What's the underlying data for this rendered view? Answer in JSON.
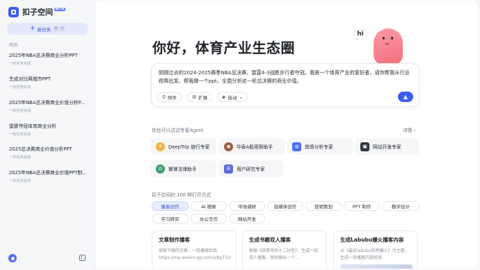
{
  "sidebar": {
    "brand_name": "扣子空间",
    "brand_badge": "BETA",
    "new_task_label": "新任务",
    "new_task_kbd": [
      "⌘",
      "K"
    ],
    "section_label": "昨天",
    "history": [
      {
        "title": "2025年NBA总决赛商业分析PPT",
        "status": "一轮任务完成"
      },
      {
        "title": "生成对比两城市PPT",
        "status": "一轮任务完成"
      },
      {
        "title": "2025年NBA总决赛商业价值分析P...",
        "status": "一轮任务完成"
      },
      {
        "title": "雷霆夺冠体育商业分析",
        "status": "一轮任务完成"
      },
      {
        "title": "2025总决赛商业价值分析PPT",
        "status": "一轮任务完成"
      },
      {
        "title": "2025年NBA总决赛商业价值PPT制...",
        "status": "一轮任务完成"
      }
    ]
  },
  "main": {
    "headline": "你好，体育产业生态圈",
    "greeting_bubble": "hi",
    "composer": {
      "text": "刚刚过去的2024-2025赛季NBA总决赛，雷霆4-3战胜步行者夺冠。我是一个体育产业的爱好者，请你帮我从行业视角出发，帮我做一个ppt，全面分析这一轮总决赛的商业价值。",
      "attach_label": "附件",
      "expand_label": "扩展",
      "mode_label": "自动"
    },
    "agents_title": "你也可以试试专家Agent",
    "details_label": "详情",
    "agents": [
      {
        "name": "DeepTrip 旅行专家",
        "color": "#f5b342",
        "glyph": "✈"
      },
      {
        "name": "华泰A股观察助手",
        "color": "#9b5b3a",
        "glyph": "◉"
      },
      {
        "name": "舆情分析专家",
        "color": "#4a6ef5",
        "glyph": "◍"
      },
      {
        "name": "网站开发专家",
        "color": "#2d3340",
        "glyph": "▣"
      },
      {
        "name": "幂律法律助手",
        "color": "#3f9b6b",
        "glyph": "⚖"
      },
      {
        "name": "用户研究专家",
        "color": "#5a6bd8",
        "glyph": "☰"
      }
    ],
    "ways_title": "扣子空间的 100 种打开方式",
    "categories": [
      "播客创作",
      "AI 搜索",
      "市场调研",
      "自媒体创作",
      "营销策划",
      "PPT 制作",
      "教学设计",
      "学习研究",
      "办公写作",
      "网站开发"
    ],
    "active_category": "播客创作",
    "cards": [
      {
        "title": "文章制作播客",
        "desc": "读取下面的文章，一段播客给我 https://mp.weixin.qq.com/s/BgT1U"
      },
      {
        "title": "生成书籍双人播客",
        "desc": "根据《结青年的十二封信》，生成一段双人播客，然后输出一个..."
      },
      {
        "title": "生成Labubu爆火播客内容",
        "desc": "以《最近labubu突然爆火》为主题，生成一段播客内容给我"
      }
    ]
  },
  "colors": {
    "accent": "#3d5cf5",
    "chip_active_bg": "#e8edff",
    "mascot": "#f2707e"
  }
}
